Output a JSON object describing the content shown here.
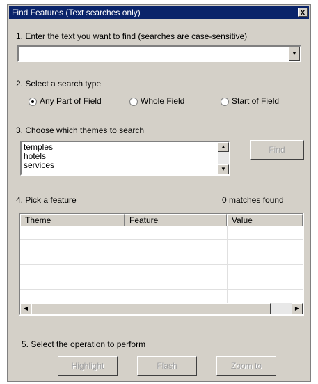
{
  "window": {
    "title": "Find Features (Text searches only)",
    "close_label": "x"
  },
  "step1": {
    "label": "1. Enter the text you want to find (searches are case-sensitive)",
    "value": ""
  },
  "step2": {
    "label": "2. Select a search type",
    "options": [
      {
        "label": "Any Part of Field",
        "selected": true
      },
      {
        "label": "Whole Field",
        "selected": false
      },
      {
        "label": "Start of Field",
        "selected": false
      }
    ]
  },
  "step3": {
    "label": "3. Choose which themes to search",
    "themes": [
      "temples",
      "hotels",
      "services"
    ],
    "find_button": "Find"
  },
  "step4": {
    "label": "4. Pick a feature",
    "matches": "0 matches found",
    "columns": [
      "Theme",
      "Feature",
      "Value"
    ]
  },
  "step5": {
    "label": "5. Select the operation to perform",
    "buttons": [
      "Highlight",
      "Flash",
      "Zoom to"
    ]
  }
}
